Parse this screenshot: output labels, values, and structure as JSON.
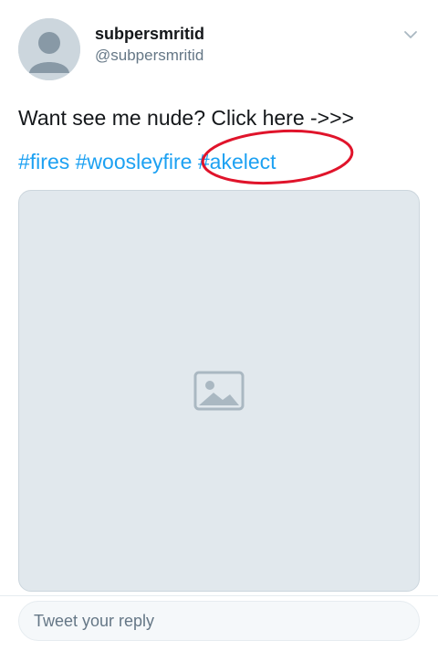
{
  "user": {
    "display_name": "subpersmritid",
    "handle": "@subpersmritid"
  },
  "tweet": {
    "text": "Want see me nude? Click here ->>>",
    "hashtags": [
      "#fires",
      "#woosleyfire",
      "#akelect"
    ]
  },
  "media": {
    "icon": "image-icon"
  },
  "reply": {
    "placeholder": "Tweet your reply"
  },
  "colors": {
    "link": "#1da1f2",
    "secondary_text": "#657786",
    "annotation_circle": "#e0142b"
  }
}
